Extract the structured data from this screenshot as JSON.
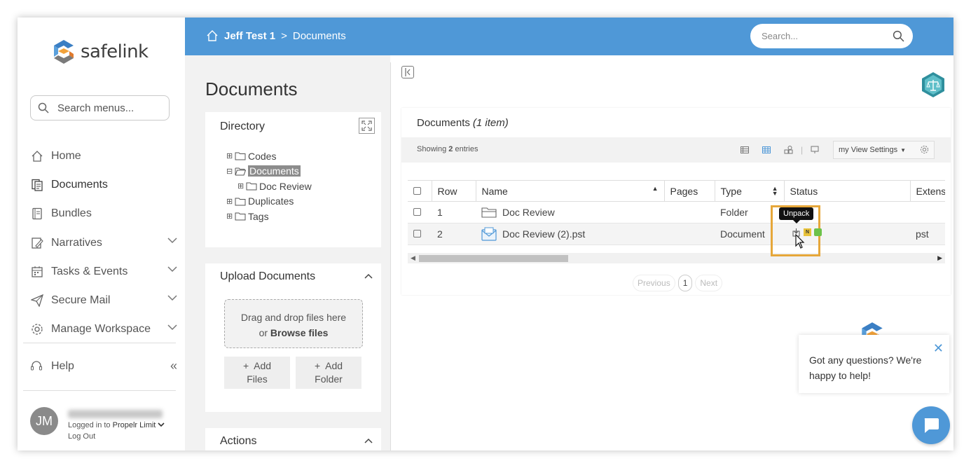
{
  "brand": {
    "name": "safelink"
  },
  "sidebar": {
    "search_placeholder": "Search menus...",
    "items": [
      {
        "label": "Home",
        "icon": "home-icon",
        "has_chevron": false
      },
      {
        "label": "Documents",
        "icon": "documents-icon",
        "has_chevron": false
      },
      {
        "label": "Bundles",
        "icon": "bundles-icon",
        "has_chevron": false
      },
      {
        "label": "Narratives",
        "icon": "narratives-icon",
        "has_chevron": true
      },
      {
        "label": "Tasks & Events",
        "icon": "calendar-icon",
        "has_chevron": true
      },
      {
        "label": "Secure Mail",
        "icon": "send-icon",
        "has_chevron": true
      },
      {
        "label": "Manage Workspace",
        "icon": "gear-icon",
        "has_chevron": true
      }
    ],
    "help_label": "Help",
    "collapse_glyph": "«",
    "user": {
      "initials": "JM",
      "logged_in_prefix": "Logged in to",
      "workspace": "Propelr Limit",
      "logout": "Log Out"
    }
  },
  "header": {
    "breadcrumb_root": "Jeff Test 1",
    "breadcrumb_sep": ">",
    "breadcrumb_current": "Documents",
    "search_placeholder": "Search..."
  },
  "docpanel": {
    "title": "Documents",
    "directory": {
      "title": "Directory",
      "tree": [
        {
          "label": "Codes",
          "level": 0,
          "expander": "⊞",
          "selected": false
        },
        {
          "label": "Documents",
          "level": 0,
          "expander": "⊟",
          "selected": true
        },
        {
          "label": "Doc Review",
          "level": 1,
          "expander": "⊞",
          "selected": false
        },
        {
          "label": "Duplicates",
          "level": 0,
          "expander": "⊞",
          "selected": false
        },
        {
          "label": "Tags",
          "level": 0,
          "expander": "⊞",
          "selected": false
        }
      ]
    },
    "upload": {
      "title": "Upload Documents",
      "drop_line1": "Drag and drop files here",
      "drop_or": "or",
      "drop_browse": "Browse files",
      "add_files": "+ Add Files",
      "add_files_l1": "+  Add",
      "add_files_l2": "Files",
      "add_folder_l1": "+  Add",
      "add_folder_l2": "Folder"
    },
    "actions_title": "Actions"
  },
  "main": {
    "card_title": "Documents",
    "card_count": "(1 item)",
    "showing_prefix": "Showing",
    "showing_count": "2",
    "showing_suffix": "entries",
    "view_settings": "my View Settings",
    "columns": [
      "Row",
      "Name",
      "Pages",
      "Type",
      "Status",
      "Extens"
    ],
    "rows": [
      {
        "row": "1",
        "name": "Doc Review",
        "pages": "",
        "type": "Folder",
        "ext": "",
        "icon": "folder-icon"
      },
      {
        "row": "2",
        "name": "Doc Review (2).pst",
        "pages": "",
        "type": "Document",
        "ext": "pst",
        "icon": "email-file-icon"
      }
    ],
    "pager": {
      "prev": "Previous",
      "page": "1",
      "next": "Next"
    },
    "tooltip": "Unpack",
    "status_badge_n": "N"
  },
  "chat": {
    "message": "Got any questions? We're happy to help!"
  },
  "colors": {
    "accent": "#4f98d7",
    "highlight": "#e6a73a",
    "badge_yellow": "#e8c23a",
    "badge_green": "#6cc24a"
  }
}
